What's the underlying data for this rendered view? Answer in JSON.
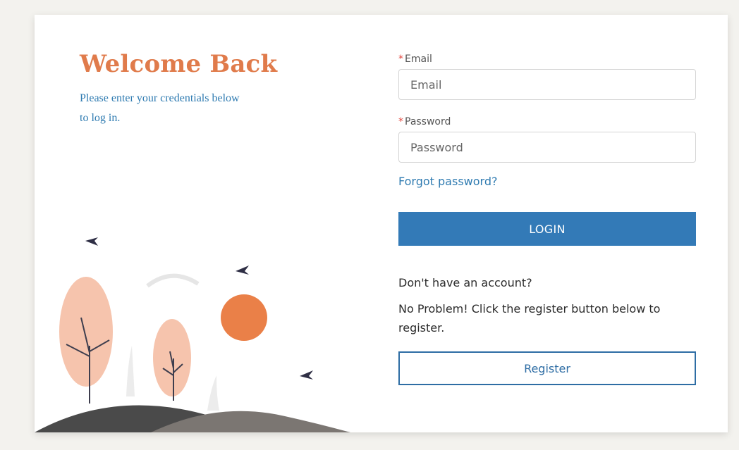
{
  "welcome": {
    "title": "Welcome Back",
    "subtitle": "Please enter your credentials below to log in."
  },
  "form": {
    "email_label": "Email",
    "email_placeholder": "Email",
    "password_label": "Password",
    "password_placeholder": "Password",
    "required_marker": "*",
    "forgot_password": "Forgot password?",
    "login_button": "LOGIN",
    "no_account": "Don't have an account?",
    "register_hint": "No Problem! Click the register button below to register.",
    "register_button": "Register"
  },
  "colors": {
    "accent_orange": "#e07b4b",
    "accent_blue": "#337ab7",
    "required_red": "#e2433b"
  }
}
